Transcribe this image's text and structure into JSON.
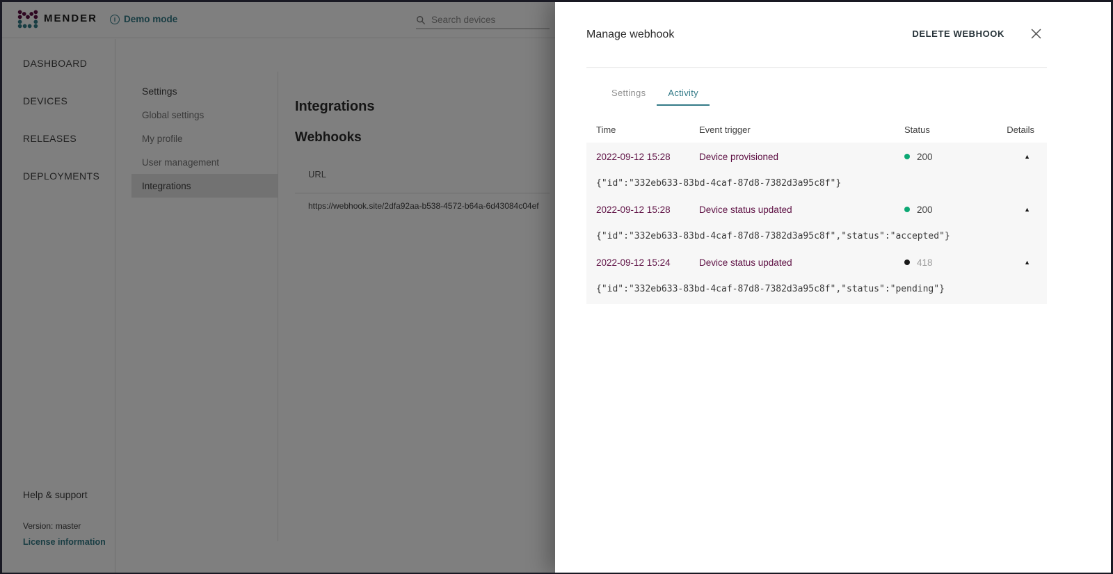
{
  "colors": {
    "accent_teal": "#337a87",
    "accent_purple": "#5d0f43",
    "status_success": "#0ca874",
    "status_error_dot": "#1a1a1a",
    "status_code_default": "#404040",
    "status_code_muted": "#9c9c9c"
  },
  "header": {
    "brand": "MENDER",
    "demo_mode_label": "Demo mode",
    "search_placeholder": "Search devices"
  },
  "sidebar": {
    "items": [
      {
        "label": "DASHBOARD"
      },
      {
        "label": "DEVICES"
      },
      {
        "label": "RELEASES"
      },
      {
        "label": "DEPLOYMENTS"
      }
    ],
    "footer": {
      "help": "Help & support",
      "version": "Version: master",
      "license": "License information"
    }
  },
  "settings_nav": {
    "title": "Settings",
    "items": [
      {
        "label": "Global settings"
      },
      {
        "label": "My profile"
      },
      {
        "label": "User management"
      },
      {
        "label": "Integrations",
        "selected": true
      }
    ]
  },
  "content": {
    "page_title": "Integrations",
    "section_title": "Webhooks",
    "url_column": "URL",
    "webhook_url": "https://webhook.site/2dfa92aa-b538-4572-b64a-6d43084c04ef"
  },
  "drawer": {
    "title": "Manage webhook",
    "delete_button": "DELETE WEBHOOK",
    "icons": {
      "close": "x-icon",
      "collapse_glyph": "▲"
    },
    "tabs": [
      {
        "label": "Settings",
        "active": false
      },
      {
        "label": "Activity",
        "active": true
      }
    ],
    "activity": {
      "columns": {
        "time": "Time",
        "trigger": "Event trigger",
        "status": "Status",
        "details": "Details"
      },
      "rows": [
        {
          "time": "2022-09-12 15:28",
          "trigger": "Device provisioned",
          "status_code": "200",
          "dot_color": "#0ca874",
          "code_color": "#404040",
          "payload": "{\"id\":\"332eb633-83bd-4caf-87d8-7382d3a95c8f\"}"
        },
        {
          "time": "2022-09-12 15:28",
          "trigger": "Device status updated",
          "status_code": "200",
          "dot_color": "#0ca874",
          "code_color": "#404040",
          "payload": "{\"id\":\"332eb633-83bd-4caf-87d8-7382d3a95c8f\",\"status\":\"accepted\"}"
        },
        {
          "time": "2022-09-12 15:24",
          "trigger": "Device status updated",
          "status_code": "418",
          "dot_color": "#1a1a1a",
          "code_color": "#9c9c9c",
          "payload": "{\"id\":\"332eb633-83bd-4caf-87d8-7382d3a95c8f\",\"status\":\"pending\"}"
        }
      ]
    }
  }
}
